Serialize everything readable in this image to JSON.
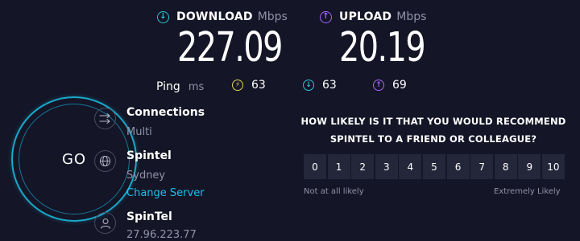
{
  "download": {
    "label": "DOWNLOAD",
    "unit": "Mbps",
    "value": "227.09",
    "icon": "arrow-down-circle-icon",
    "color": "#29c3d4"
  },
  "upload": {
    "label": "UPLOAD",
    "unit": "Mbps",
    "value": "20.19",
    "icon": "arrow-up-circle-icon",
    "color": "#a566ff"
  },
  "ping": {
    "label": "Ping",
    "unit": "ms",
    "idle": {
      "value": "63",
      "icon": "bolt-circle-icon",
      "color": "#ddd55a"
    },
    "download": {
      "value": "63",
      "icon": "arrow-down-circle-icon",
      "color": "#29c3d4"
    },
    "upload": {
      "value": "69",
      "icon": "arrow-up-circle-icon",
      "color": "#a566ff"
    }
  },
  "go_button": {
    "label": "GO",
    "ring_color": "#1aa8c9"
  },
  "connections": {
    "title": "Connections",
    "value": "Multi",
    "icon": "connections-arrows-icon"
  },
  "server": {
    "name": "Spintel",
    "location": "Sydney",
    "change_label": "Change Server",
    "icon": "globe-icon",
    "link_color": "#1cc0ec"
  },
  "provider": {
    "name": "SpinTel",
    "ip": "27.96.223.77",
    "icon": "user-icon"
  },
  "survey": {
    "question_line1": "HOW LIKELY IS IT THAT YOU WOULD RECOMMEND",
    "question_line2": "SPINTEL TO A FRIEND OR COLLEAGUE?",
    "scale": [
      "0",
      "1",
      "2",
      "3",
      "4",
      "5",
      "6",
      "7",
      "8",
      "9",
      "10"
    ],
    "low_label": "Not at all likely",
    "high_label": "Extremely Likely"
  }
}
